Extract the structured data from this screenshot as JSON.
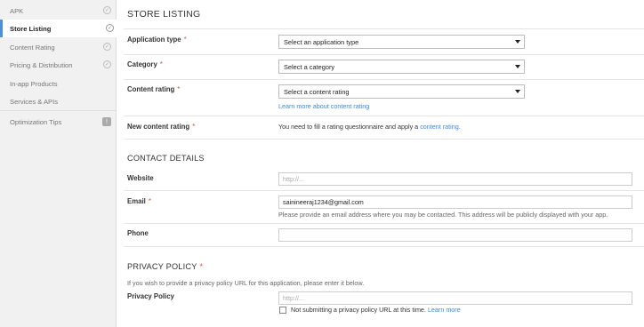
{
  "sidebar": {
    "items": [
      {
        "label": "APK",
        "status": "✓"
      },
      {
        "label": "Store Listing",
        "status": "✓"
      },
      {
        "label": "Content Rating",
        "status": "✓"
      },
      {
        "label": "Pricing & Distribution",
        "status": "✓"
      },
      {
        "label": "In-app Products"
      },
      {
        "label": "Services & APIs"
      }
    ],
    "optimization": {
      "label": "Optimization Tips",
      "badge": "!"
    }
  },
  "page": {
    "title": "STORE LISTING"
  },
  "fields": {
    "app_type": {
      "label": "Application type",
      "required": "*",
      "value": "Select an application type"
    },
    "category": {
      "label": "Category",
      "required": "*",
      "value": "Select a category"
    },
    "content_rating": {
      "label": "Content rating",
      "required": "*",
      "value": "Select a content rating",
      "link": "Learn more about content rating"
    },
    "new_content_rating": {
      "label": "New content rating",
      "required": "*",
      "text": "You need to fill a rating questionnaire and apply a",
      "link": "content rating."
    }
  },
  "contact": {
    "heading": "CONTACT DETAILS",
    "website": {
      "label": "Website",
      "placeholder": "http://..."
    },
    "email": {
      "label": "Email",
      "required": "*",
      "value": "saininеeraj1234@gmail.com",
      "help": "Please provide an email address where you may be contacted. This address will be publicly displayed with your app."
    },
    "phone": {
      "label": "Phone",
      "value": ""
    }
  },
  "privacy": {
    "heading": "PRIVACY POLICY",
    "required": "*",
    "desc": "If you wish to provide a privacy policy URL for this application, please enter it below.",
    "policy": {
      "label": "Privacy Policy",
      "placeholder": "http://..."
    },
    "checkbox_label": "Not submitting a privacy policy URL at this time.",
    "learn_more": "Learn more"
  }
}
